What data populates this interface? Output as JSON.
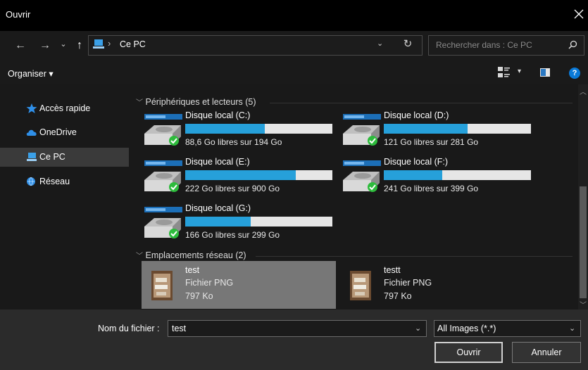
{
  "window": {
    "title": "Ouvrir",
    "close_icon": "close-icon"
  },
  "nav": {
    "back_icon": "←",
    "forward_icon": "→",
    "recent_icon": "⌄",
    "up_icon": "↑",
    "address_separator": "›",
    "address_text": "Ce PC",
    "address_dropdown": "⌄",
    "refresh_icon": "↻",
    "search_placeholder": "Rechercher dans : Ce PC"
  },
  "toolbar": {
    "organiser_label": "Organiser ▾",
    "view_dropdown": "▾",
    "help": "?"
  },
  "sidebar": {
    "items": [
      {
        "label": "Accès rapide",
        "icon": "star-icon"
      },
      {
        "label": "OneDrive",
        "icon": "cloud-icon"
      },
      {
        "label": "Ce PC",
        "icon": "computer-icon",
        "selected": true
      },
      {
        "label": "Réseau",
        "icon": "network-icon"
      }
    ]
  },
  "groups": {
    "devices": {
      "label": "Périphériques et lecteurs (5)"
    },
    "network": {
      "label": "Emplacements réseau (2)"
    }
  },
  "drives": [
    {
      "name": "Disque local (C:)",
      "free": "88,6 Go libres sur 194 Go",
      "used_fraction": 0.543
    },
    {
      "name": "Disque local (D:)",
      "free": "121 Go libres sur 281 Go",
      "used_fraction": 0.569
    },
    {
      "name": "Disque local (E:)",
      "free": "222 Go libres sur 900 Go",
      "used_fraction": 0.753
    },
    {
      "name": "Disque local (F:)",
      "free": "241 Go libres sur 399 Go",
      "used_fraction": 0.396
    },
    {
      "name": "Disque local (G:)",
      "free": "166 Go libres sur 299 Go",
      "used_fraction": 0.445
    }
  ],
  "network_items": [
    {
      "name": "test",
      "type": "Fichier PNG",
      "size": "797 Ko",
      "selected": true
    },
    {
      "name": "testt",
      "type": "Fichier PNG",
      "size": "797 Ko",
      "selected": false
    }
  ],
  "footer": {
    "filename_label": "Nom du fichier :",
    "filename_value": "test",
    "filter_value": "All Images (*.*)",
    "dropdown": "⌄",
    "open_label": "Ouvrir",
    "cancel_label": "Annuler"
  },
  "colors": {
    "accent": "#26a0da",
    "selection": "#777777",
    "check": "#2dbb3c"
  }
}
